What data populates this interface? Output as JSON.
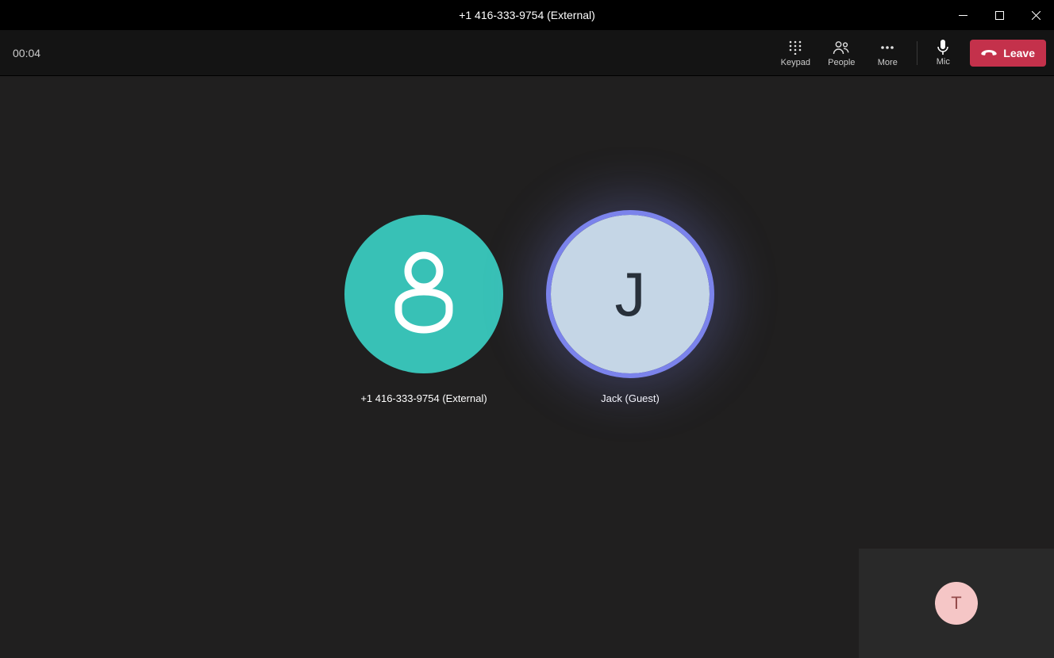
{
  "titlebar": {
    "title": "+1 416-333-9754 (External)"
  },
  "toolbar": {
    "timer": "00:04",
    "keypad_label": "Keypad",
    "people_label": "People",
    "more_label": "More",
    "mic_label": "Mic",
    "leave_label": "Leave"
  },
  "participants": [
    {
      "label": "+1 416-333-9754 (External)",
      "avatar_type": "anonymous",
      "avatar_bg": "#38C1B6",
      "speaking": false
    },
    {
      "label": "Jack (Guest)",
      "avatar_type": "initial",
      "initial": "J",
      "avatar_bg": "#C5D6E6",
      "speaking": true
    }
  ],
  "self_preview": {
    "initial": "T",
    "avatar_bg": "#F5C6C6"
  }
}
